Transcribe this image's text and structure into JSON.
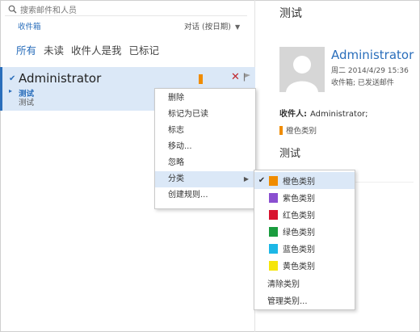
{
  "search": {
    "placeholder": "搜索邮件和人员"
  },
  "folder": "收件箱",
  "sort": {
    "label": "对话 (按日期)"
  },
  "filters": [
    "所有",
    "未读",
    "收件人是我",
    "已标记"
  ],
  "mail": {
    "sender": "Administrator",
    "subject": "测试",
    "preview": "测试"
  },
  "reading": {
    "title": "测试",
    "sender": "Administrator",
    "date": "周二 2014/4/29 15:36",
    "folder_line": "收件箱; 已发送邮件",
    "to_label": "收件人:",
    "to_value": "Administrator;",
    "category": "橙色类别",
    "body_title": "测试"
  },
  "context_menu": {
    "items": [
      "删除",
      "标记为已读",
      "标志",
      "移动...",
      "忽略",
      "分类",
      "创建规则..."
    ]
  },
  "category_menu": {
    "items": [
      {
        "label": "橙色类别",
        "color": "#f08c00",
        "checked": true
      },
      {
        "label": "紫色类别",
        "color": "#8a4fd0"
      },
      {
        "label": "红色类别",
        "color": "#d8132f"
      },
      {
        "label": "绿色类别",
        "color": "#1a9c3e"
      },
      {
        "label": "蓝色类别",
        "color": "#1cb7e6"
      },
      {
        "label": "黄色类别",
        "color": "#f5e50a"
      }
    ],
    "clear_label": "清除类别",
    "manage_label": "管理类别..."
  }
}
